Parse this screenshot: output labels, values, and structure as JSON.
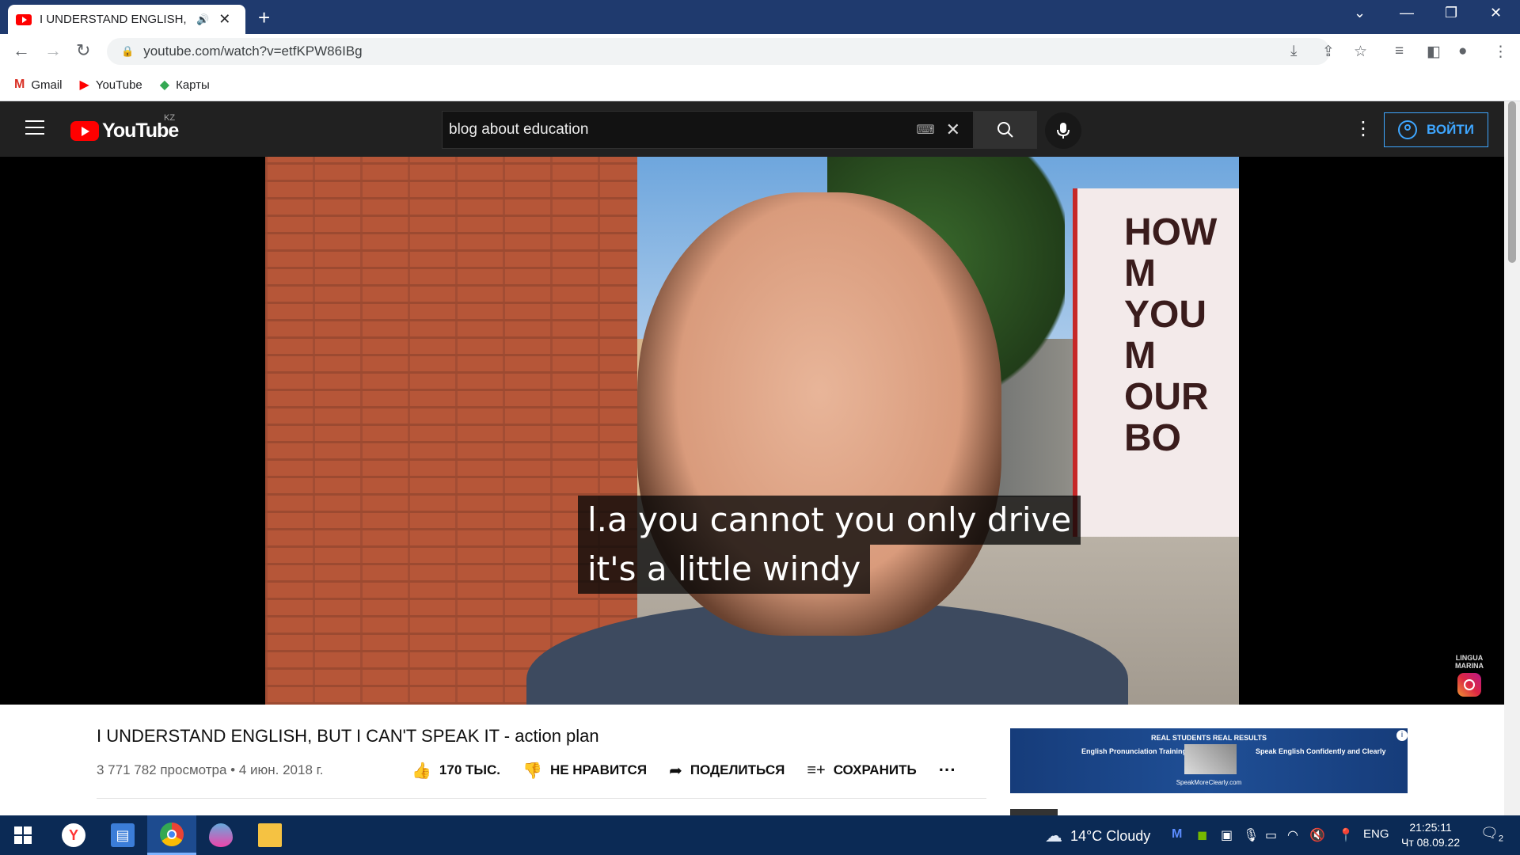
{
  "browser": {
    "tab_title": "I UNDERSTAND ENGLISH, BU",
    "url": "youtube.com/watch?v=etfKPW86IBg",
    "bookmarks": [
      {
        "label": "Gmail",
        "icon": "gmail-icon"
      },
      {
        "label": "YouTube",
        "icon": "youtube-icon"
      },
      {
        "label": "Карты",
        "icon": "maps-icon"
      }
    ]
  },
  "youtube": {
    "logo_text": "YouTube",
    "region": "KZ",
    "search_value": "blog about education",
    "signin_label": "ВОЙТИ"
  },
  "video": {
    "caption_line1": "l.a you cannot you only drive",
    "caption_line2": "it's a little windy",
    "bus_text": "HOW M\nYOU M\nOUR BO",
    "watermark_line1": "LINGUA",
    "watermark_line2": "MARINA",
    "title": "I UNDERSTAND ENGLISH, BUT I CAN'T SPEAK IT - action plan",
    "meta": "3 771 782 просмотра • 4 июн. 2018 г.",
    "actions": {
      "like": "170 ТЫС.",
      "dislike": "НЕ НРАВИТСЯ",
      "share": "ПОДЕЛИТЬСЯ",
      "save": "СОХРАНИТЬ"
    }
  },
  "ad": {
    "headline": "REAL STUDENTS REAL RESULTS",
    "left_text": "English Pronunciation Training",
    "right_text": "Speak English Confidently and Clearly",
    "site": "SpeakMoreClearly.com"
  },
  "taskbar": {
    "weather": "14°C  Cloudy",
    "lang": "ENG",
    "time": "21:25:11",
    "date": "Чт 08.09.22",
    "notifications": "2"
  },
  "colors": {
    "titlebar": "#1f3a6e",
    "yt_header": "#212121",
    "accent_blue": "#3ea6ff",
    "yt_red": "#ff0000",
    "taskbar": "#0b2a55"
  }
}
